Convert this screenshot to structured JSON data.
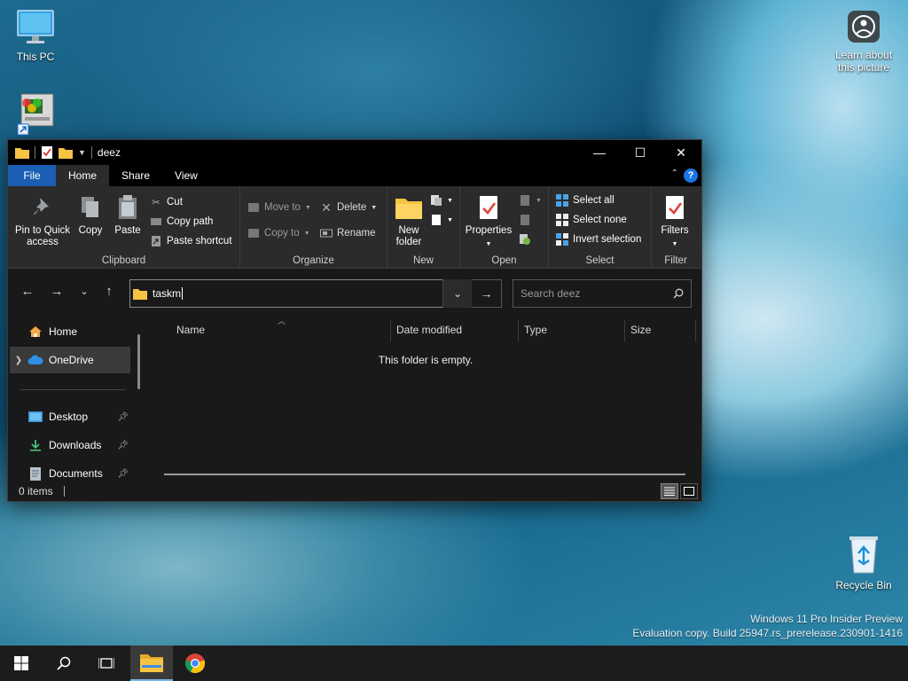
{
  "desktop": {
    "icons": [
      {
        "label": "This PC"
      },
      {
        "label": ""
      },
      {
        "label": "Learn about this picture"
      },
      {
        "label": "Recycle Bin"
      }
    ],
    "watermark": {
      "line1": "Windows 11 Pro Insider Preview",
      "line2": "Evaluation copy. Build 25947.rs_prerelease.230901-1416"
    }
  },
  "window": {
    "title": "deez",
    "controls": {
      "minimize": "—",
      "maximize": "☐",
      "close": "✕"
    },
    "tabs": [
      "File",
      "Home",
      "Share",
      "View"
    ],
    "active_tab": "Home",
    "ribbon": {
      "clipboard": {
        "label": "Clipboard",
        "pin": "Pin to Quick access",
        "copy": "Copy",
        "paste": "Paste",
        "cut": "Cut",
        "copy_path": "Copy path",
        "paste_shortcut": "Paste shortcut"
      },
      "organize": {
        "label": "Organize",
        "move_to": "Move to",
        "copy_to": "Copy to",
        "delete": "Delete",
        "rename": "Rename"
      },
      "new": {
        "label": "New",
        "new_folder": "New folder"
      },
      "open": {
        "label": "Open",
        "properties": "Properties"
      },
      "select": {
        "label": "Select",
        "select_all": "Select all",
        "select_none": "Select none",
        "invert_selection": "Invert selection"
      },
      "filter": {
        "label": "Filter",
        "filters": "Filters"
      }
    },
    "address": {
      "value": "taskm"
    },
    "search": {
      "placeholder": "Search deez"
    },
    "nav": {
      "items": [
        {
          "label": "Home"
        },
        {
          "label": "OneDrive"
        },
        {
          "label": "Desktop"
        },
        {
          "label": "Downloads"
        },
        {
          "label": "Documents"
        }
      ]
    },
    "columns": [
      "Name",
      "Date modified",
      "Type",
      "Size"
    ],
    "empty_message": "This folder is empty.",
    "status": {
      "items": "0 items"
    }
  },
  "colors": {
    "accent": "#1a5fb4",
    "window_bg": "#191919",
    "ribbon_bg": "#2b2b2b",
    "folder_yellow": "#f6c343"
  }
}
